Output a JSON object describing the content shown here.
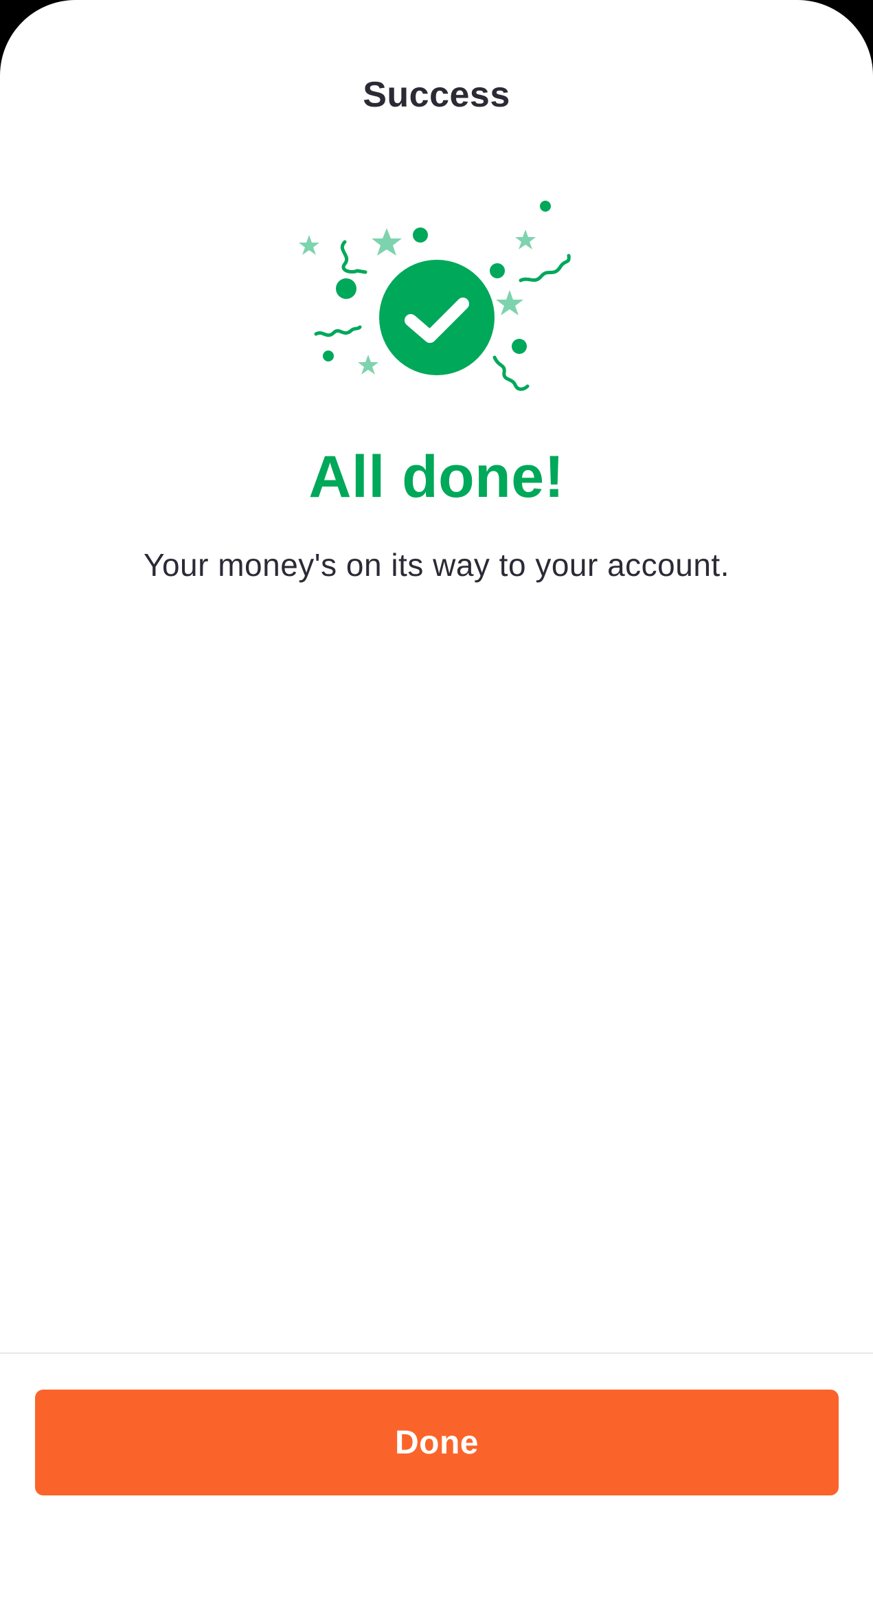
{
  "header": {
    "title": "Success"
  },
  "illustration": {
    "icon": "success-check-confetti-icon",
    "colors": {
      "primary": "#00a85a",
      "accent_light": "#7dd3ad"
    }
  },
  "main": {
    "headline": "All done!",
    "message": "Your money's on its way to your account."
  },
  "footer": {
    "done_label": "Done",
    "button_color": "#fa642b"
  }
}
